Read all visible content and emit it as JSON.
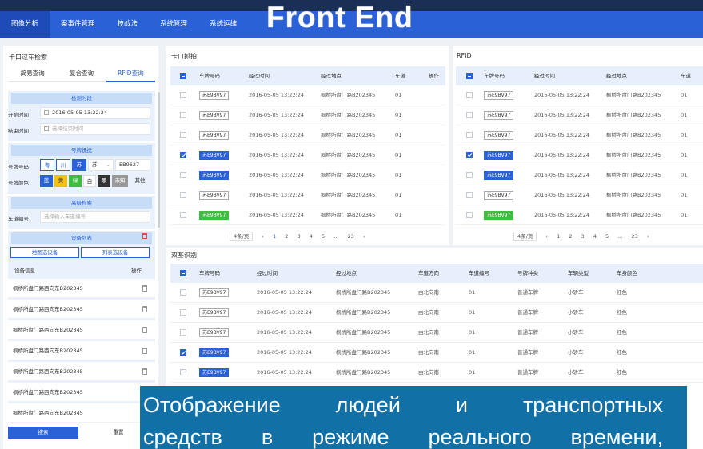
{
  "banner": "Front End",
  "nav": [
    "图像分析",
    "案事件管理",
    "技战法",
    "系统管理",
    "系统运维"
  ],
  "left": {
    "title": "卡口过车检索",
    "tabs": [
      "简易查询",
      "复合查询",
      "RFID查询"
    ],
    "s1": "检测时段",
    "start_label": "开始时间",
    "start_value": "2016-05-05 13:22:24",
    "end_label": "结束时间",
    "end_ph": "选择结束时间",
    "s2": "号牌抚抚",
    "plate_label": "号牌号码",
    "plate_prov": [
      "粤",
      "川",
      "苏"
    ],
    "plate_sel": "苏",
    "plate_val": "EB9627",
    "color_label": "号牌颜色",
    "colors": [
      "蓝",
      "黄",
      "绿",
      "白",
      "黑",
      "未知",
      "其他"
    ],
    "s3": "高级检索",
    "lane_label": "车道编号",
    "lane_ph": "选择输入车道编号",
    "s4": "设备列表",
    "map_btn": "地图选设备",
    "list_btn": "列表选设备",
    "dev_col": "设备信息",
    "op_col": "操作",
    "devices": [
      "枫桥所盘门路西向东B202345",
      "枫桥所盘门路西向东B202345",
      "枫桥所盘门路西向东B202345",
      "枫桥所盘门路西向东B202345",
      "枫桥所盘门路西向东B202345",
      "枫桥所盘门路西向东B202345",
      "枫桥所盘门路西向东B202345"
    ],
    "search_btn": "搜索",
    "reset_btn": "重置"
  },
  "kakou": {
    "title": "卡口抓拍",
    "cols": [
      "车牌号码",
      "经过时间",
      "经过地点",
      "车道",
      "操作"
    ],
    "rows": [
      {
        "plate": "苏E9BV97",
        "time": "2016-05-05 13:22:24",
        "place": "枫桥所盘门路B202345",
        "lane": "01"
      },
      {
        "plate": "苏E9BV97",
        "time": "2016-05-05 13:22:24",
        "place": "枫桥所盘门路B202345",
        "lane": "01"
      },
      {
        "plate": "苏E9BV97",
        "time": "2016-05-05 13:22:24",
        "place": "枫桥所盘门路B202345",
        "lane": "01"
      },
      {
        "plate": "苏E9BV97",
        "time": "2016-05-05 13:22:24",
        "place": "枫桥所盘门路B202345",
        "lane": "01"
      },
      {
        "plate": "苏E9BV97",
        "time": "2016-05-05 13:22:24",
        "place": "枫桥所盘门路B202345",
        "lane": "01"
      },
      {
        "plate": "苏E9BV97",
        "time": "2016-05-05 13:22:24",
        "place": "枫桥所盘门路B202345",
        "lane": "01"
      },
      {
        "plate": "苏E9BV97",
        "time": "2016-05-05 13:22:24",
        "place": "枫桥所盘门路B202345",
        "lane": "01"
      }
    ],
    "pager": {
      "size": "4条/页",
      "pages": [
        "1",
        "2",
        "3",
        "4",
        "5",
        "...",
        "23"
      ]
    }
  },
  "rfid": {
    "title": "RFID",
    "cols": [
      "车牌号码",
      "经过时间",
      "经过地点",
      "车道"
    ],
    "rows": [
      {
        "plate": "苏E9BV97",
        "time": "2016-05-05 13:22:24",
        "place": "枫桥所盘门路B202345",
        "lane": "01"
      },
      {
        "plate": "苏E9BV97",
        "time": "2016-05-05 13:22:24",
        "place": "枫桥所盘门路B202345",
        "lane": "01"
      },
      {
        "plate": "苏E9BV97",
        "time": "2016-05-05 13:22:24",
        "place": "枫桥所盘门路B202345",
        "lane": "01"
      },
      {
        "plate": "苏E9BV97",
        "time": "2016-05-05 13:22:24",
        "place": "枫桥所盘门路B202345",
        "lane": "01"
      },
      {
        "plate": "苏E9BV97",
        "time": "2016-05-05 13:22:24",
        "place": "枫桥所盘门路B202345",
        "lane": "01"
      },
      {
        "plate": "苏E9BV97",
        "time": "2016-05-05 13:22:24",
        "place": "枫桥所盘门路B202345",
        "lane": "01"
      },
      {
        "plate": "苏E9BV97",
        "time": "2016-05-05 13:22:24",
        "place": "枫桥所盘门路B202345",
        "lane": "01"
      }
    ],
    "pager": {
      "size": "4条/页",
      "pages": [
        "1",
        "2",
        "3",
        "4",
        "5",
        "...",
        "23"
      ]
    }
  },
  "dual": {
    "title": "双基识别",
    "cols": [
      "车牌号码",
      "经过时间",
      "经过地点",
      "车道方向",
      "车道编号",
      "号牌种类",
      "车辆类型",
      "车身颜色"
    ],
    "rows": [
      {
        "plate": "苏E9BV97",
        "time": "2016-05-05 13:22:24",
        "place": "枫桥所盘门路B202345",
        "dir": "由北向南",
        "lane": "01",
        "kind": "普通车牌",
        "type": "小轿车",
        "color": "红色"
      },
      {
        "plate": "苏E9BV97",
        "time": "2016-05-05 13:22:24",
        "place": "枫桥所盘门路B202345",
        "dir": "由北向南",
        "lane": "01",
        "kind": "普通车牌",
        "type": "小轿车",
        "color": "红色"
      },
      {
        "plate": "苏E9BV97",
        "time": "2016-05-05 13:22:24",
        "place": "枫桥所盘门路B202345",
        "dir": "由北向南",
        "lane": "01",
        "kind": "普通车牌",
        "type": "小轿车",
        "color": "红色"
      },
      {
        "plate": "苏E9BV97",
        "time": "2016-05-05 13:22:24",
        "place": "枫桥所盘门路B202345",
        "dir": "由北向南",
        "lane": "01",
        "kind": "普通车牌",
        "type": "小轿车",
        "color": "红色"
      },
      {
        "plate": "苏E9BV97",
        "time": "2016-05-05 13:22:24",
        "place": "枫桥所盘门路B202345",
        "dir": "由北向南",
        "lane": "01",
        "kind": "普通车牌",
        "type": "小轿车",
        "color": "红色"
      }
    ]
  },
  "overlay": {
    "line1": [
      "Отображение",
      "людей",
      "и",
      "транспортных"
    ],
    "line2": [
      "средств",
      "в",
      "режиме",
      "реального",
      "времени,"
    ]
  },
  "colors": {
    "accent": "#2b61d6",
    "nav": "#2b61d6",
    "overlay": "#1170a6",
    "green_plate": "#3fbd3f"
  }
}
